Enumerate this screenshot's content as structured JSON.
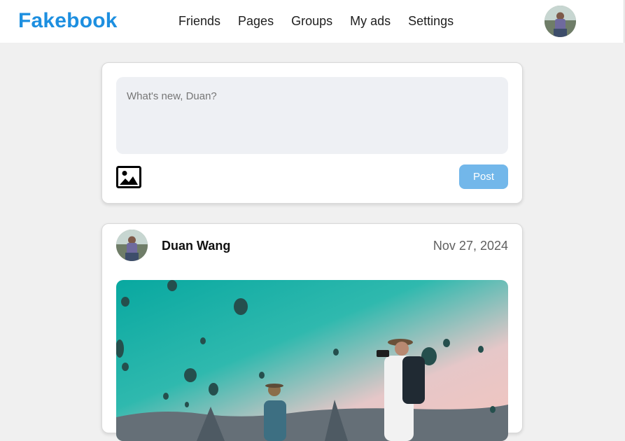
{
  "header": {
    "logo": "Fakebook",
    "nav": [
      "Friends",
      "Pages",
      "Groups",
      "My ads",
      "Settings"
    ]
  },
  "composer": {
    "placeholder": "What's new, Duan?",
    "post_label": "Post",
    "image_icon": "image-icon"
  },
  "post": {
    "author": "Duan Wang",
    "date": "Nov 27, 2024"
  },
  "colors": {
    "brand": "#1d8fe0",
    "post_button": "#72b7ea",
    "page_background": "#f0f0f0",
    "input_background": "#eef0f4"
  }
}
